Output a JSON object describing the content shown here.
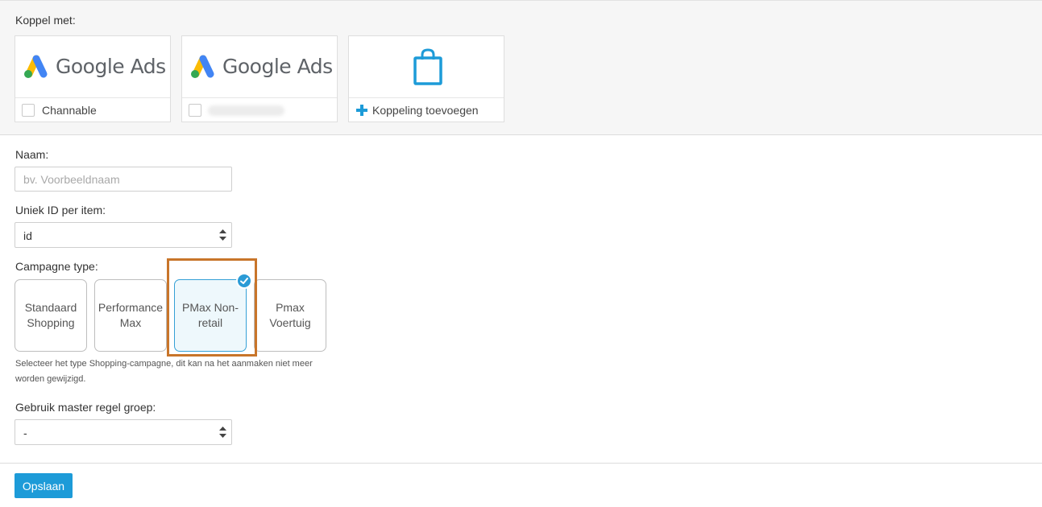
{
  "connect": {
    "title": "Koppel met:",
    "cards": [
      {
        "logo_text": "Google Ads",
        "label": "Channable",
        "checked": false
      },
      {
        "logo_text": "Google Ads",
        "label": "",
        "checked": false
      },
      {
        "label": "Koppeling toevoegen",
        "icon": "shopping-bag-icon"
      }
    ]
  },
  "form": {
    "name_label": "Naam:",
    "name_placeholder": "bv. Voorbeeldnaam",
    "name_value": "",
    "unique_id_label": "Uniek ID per item:",
    "unique_id_value": "id",
    "campaign_type_label": "Campagne type:",
    "campaign_types": [
      {
        "label": "Standaard Shopping",
        "selected": false
      },
      {
        "label": "Performance Max",
        "selected": false
      },
      {
        "label": "PMax Non-retail",
        "selected": true
      },
      {
        "label": "Pmax Voertuig",
        "selected": false
      }
    ],
    "campaign_type_help": "Selecteer het type Shopping-campagne, dit kan na het aanmaken niet meer worden gewijzigd.",
    "master_group_label": "Gebruik master regel groep:",
    "master_group_value": "-"
  },
  "actions": {
    "save_label": "Opslaan"
  },
  "colors": {
    "primary": "#1d9bd8",
    "highlight": "#c8752a",
    "ga_blue": "#4285f4",
    "ga_yellow": "#fbbc04",
    "ga_green": "#34a853"
  }
}
